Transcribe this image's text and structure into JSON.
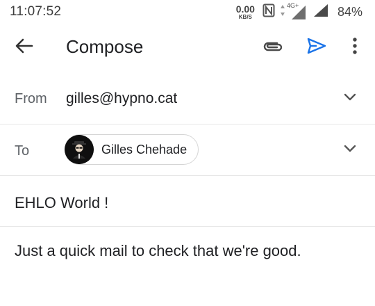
{
  "status_bar": {
    "time": "11:07:52",
    "net_speed": "0.00",
    "net_unit": "KB/S",
    "network_type": "4G+",
    "battery": "84%"
  },
  "app_bar": {
    "title": "Compose",
    "icons": [
      "back-arrow-icon",
      "paperclip-icon",
      "send-icon",
      "more-vert-icon"
    ]
  },
  "from": {
    "label": "From",
    "value": "gilles@hypno.cat"
  },
  "to": {
    "label": "To",
    "recipient_name": "Gilles Chehade"
  },
  "subject": "EHLO World !",
  "body": "Just a quick mail to check that we're good.",
  "colors": {
    "send": "#1a73e8",
    "text": "#202124",
    "secondary": "#5f6368",
    "divider": "#e6e6e6"
  }
}
